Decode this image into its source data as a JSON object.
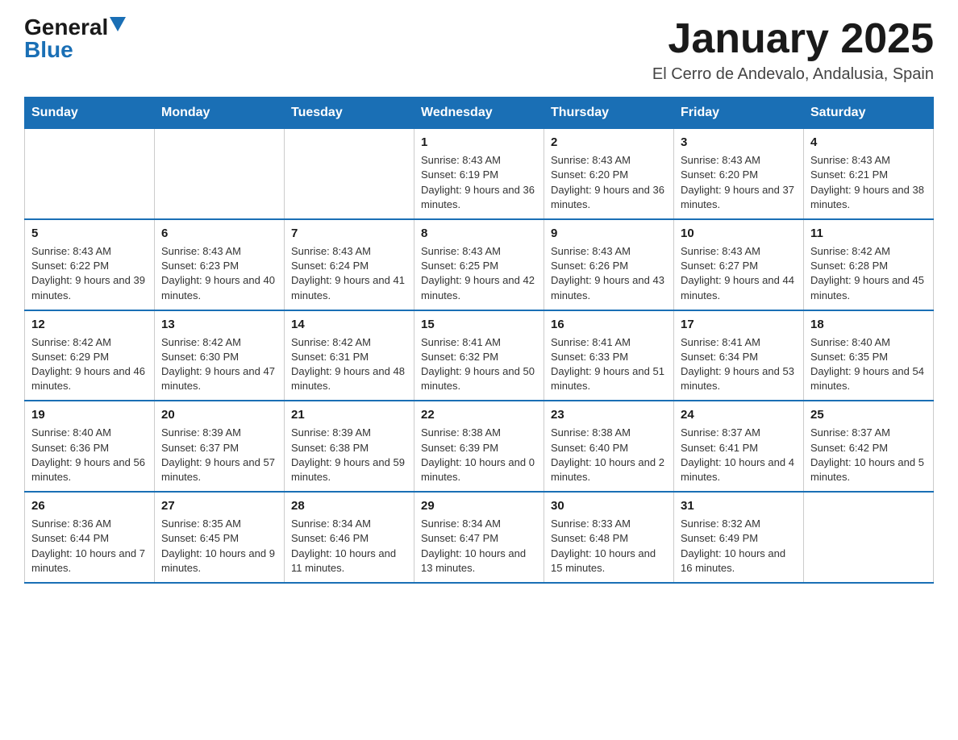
{
  "header": {
    "logo_text_general": "General",
    "logo_text_blue": "Blue",
    "month_title": "January 2025",
    "location": "El Cerro de Andevalo, Andalusia, Spain"
  },
  "calendar": {
    "days_of_week": [
      "Sunday",
      "Monday",
      "Tuesday",
      "Wednesday",
      "Thursday",
      "Friday",
      "Saturday"
    ],
    "weeks": [
      [
        {
          "day": "",
          "info": ""
        },
        {
          "day": "",
          "info": ""
        },
        {
          "day": "",
          "info": ""
        },
        {
          "day": "1",
          "info": "Sunrise: 8:43 AM\nSunset: 6:19 PM\nDaylight: 9 hours and 36 minutes."
        },
        {
          "day": "2",
          "info": "Sunrise: 8:43 AM\nSunset: 6:20 PM\nDaylight: 9 hours and 36 minutes."
        },
        {
          "day": "3",
          "info": "Sunrise: 8:43 AM\nSunset: 6:20 PM\nDaylight: 9 hours and 37 minutes."
        },
        {
          "day": "4",
          "info": "Sunrise: 8:43 AM\nSunset: 6:21 PM\nDaylight: 9 hours and 38 minutes."
        }
      ],
      [
        {
          "day": "5",
          "info": "Sunrise: 8:43 AM\nSunset: 6:22 PM\nDaylight: 9 hours and 39 minutes."
        },
        {
          "day": "6",
          "info": "Sunrise: 8:43 AM\nSunset: 6:23 PM\nDaylight: 9 hours and 40 minutes."
        },
        {
          "day": "7",
          "info": "Sunrise: 8:43 AM\nSunset: 6:24 PM\nDaylight: 9 hours and 41 minutes."
        },
        {
          "day": "8",
          "info": "Sunrise: 8:43 AM\nSunset: 6:25 PM\nDaylight: 9 hours and 42 minutes."
        },
        {
          "day": "9",
          "info": "Sunrise: 8:43 AM\nSunset: 6:26 PM\nDaylight: 9 hours and 43 minutes."
        },
        {
          "day": "10",
          "info": "Sunrise: 8:43 AM\nSunset: 6:27 PM\nDaylight: 9 hours and 44 minutes."
        },
        {
          "day": "11",
          "info": "Sunrise: 8:42 AM\nSunset: 6:28 PM\nDaylight: 9 hours and 45 minutes."
        }
      ],
      [
        {
          "day": "12",
          "info": "Sunrise: 8:42 AM\nSunset: 6:29 PM\nDaylight: 9 hours and 46 minutes."
        },
        {
          "day": "13",
          "info": "Sunrise: 8:42 AM\nSunset: 6:30 PM\nDaylight: 9 hours and 47 minutes."
        },
        {
          "day": "14",
          "info": "Sunrise: 8:42 AM\nSunset: 6:31 PM\nDaylight: 9 hours and 48 minutes."
        },
        {
          "day": "15",
          "info": "Sunrise: 8:41 AM\nSunset: 6:32 PM\nDaylight: 9 hours and 50 minutes."
        },
        {
          "day": "16",
          "info": "Sunrise: 8:41 AM\nSunset: 6:33 PM\nDaylight: 9 hours and 51 minutes."
        },
        {
          "day": "17",
          "info": "Sunrise: 8:41 AM\nSunset: 6:34 PM\nDaylight: 9 hours and 53 minutes."
        },
        {
          "day": "18",
          "info": "Sunrise: 8:40 AM\nSunset: 6:35 PM\nDaylight: 9 hours and 54 minutes."
        }
      ],
      [
        {
          "day": "19",
          "info": "Sunrise: 8:40 AM\nSunset: 6:36 PM\nDaylight: 9 hours and 56 minutes."
        },
        {
          "day": "20",
          "info": "Sunrise: 8:39 AM\nSunset: 6:37 PM\nDaylight: 9 hours and 57 minutes."
        },
        {
          "day": "21",
          "info": "Sunrise: 8:39 AM\nSunset: 6:38 PM\nDaylight: 9 hours and 59 minutes."
        },
        {
          "day": "22",
          "info": "Sunrise: 8:38 AM\nSunset: 6:39 PM\nDaylight: 10 hours and 0 minutes."
        },
        {
          "day": "23",
          "info": "Sunrise: 8:38 AM\nSunset: 6:40 PM\nDaylight: 10 hours and 2 minutes."
        },
        {
          "day": "24",
          "info": "Sunrise: 8:37 AM\nSunset: 6:41 PM\nDaylight: 10 hours and 4 minutes."
        },
        {
          "day": "25",
          "info": "Sunrise: 8:37 AM\nSunset: 6:42 PM\nDaylight: 10 hours and 5 minutes."
        }
      ],
      [
        {
          "day": "26",
          "info": "Sunrise: 8:36 AM\nSunset: 6:44 PM\nDaylight: 10 hours and 7 minutes."
        },
        {
          "day": "27",
          "info": "Sunrise: 8:35 AM\nSunset: 6:45 PM\nDaylight: 10 hours and 9 minutes."
        },
        {
          "day": "28",
          "info": "Sunrise: 8:34 AM\nSunset: 6:46 PM\nDaylight: 10 hours and 11 minutes."
        },
        {
          "day": "29",
          "info": "Sunrise: 8:34 AM\nSunset: 6:47 PM\nDaylight: 10 hours and 13 minutes."
        },
        {
          "day": "30",
          "info": "Sunrise: 8:33 AM\nSunset: 6:48 PM\nDaylight: 10 hours and 15 minutes."
        },
        {
          "day": "31",
          "info": "Sunrise: 8:32 AM\nSunset: 6:49 PM\nDaylight: 10 hours and 16 minutes."
        },
        {
          "day": "",
          "info": ""
        }
      ]
    ]
  }
}
